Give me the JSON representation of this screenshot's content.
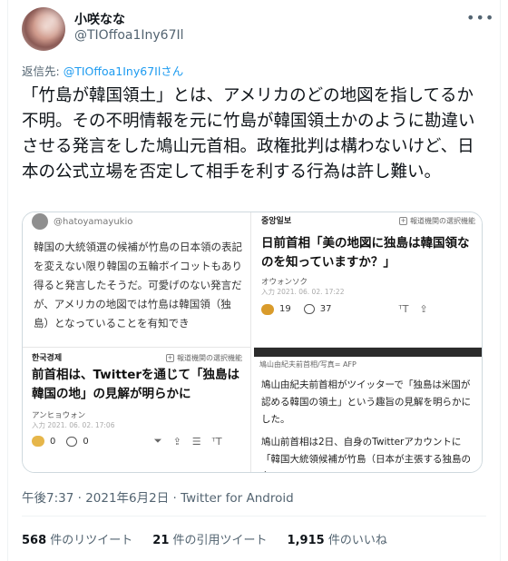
{
  "author": {
    "name": "小咲なな",
    "handle": "@TIOffoa1Iny67Il"
  },
  "reply": {
    "prefix": "返信先:",
    "target": "@TIOffoa1Iny67Ilさん"
  },
  "tweet_text": "「竹島が韓国領土」とは、アメリカのどの地図を指してるか不明。その不明情報を元に竹島が韓国領土かのように勘違いさせる発言をした鳩山元首相。政権批判は構わないけど、日本の公式立場を否定して相手を利する行為は許し難い。",
  "media": {
    "hato": {
      "handle": "@hatoyamayukio",
      "body": "韓国の大統領選の候補が竹島の日本領の表記を変えない限り韓国の五輪ボイコットもあり得ると発言したそうだ。可愛げのない発言だが、アメリカの地図では竹島は韓国領（独島）となっていることを有知でき"
    },
    "joongang": {
      "source": "중앙일보",
      "selection": "報道機関の選択機能",
      "headline": "日前首相「美の地図に独島は韓国領なのを知っていますか？」",
      "author": "オウォンソク",
      "date": "入力 2021. 06. 02. 17:22",
      "reactions": "19",
      "comments": "37"
    },
    "hankyung": {
      "source": "한국경제",
      "selection": "報道機関の選択機能",
      "headline": "前首相は、Twitterを通じて「独島は韓国の地」の見解が明らかに",
      "author": "アンヒョウォン",
      "date": "入力 2021. 06. 02. 17:06",
      "reactions": "0",
      "comments": "0"
    },
    "afp": {
      "caption": "鳩山由紀夫前首相/写真= AFP",
      "para1": "鳩山由紀夫前首相がツイッターで「独島は米国が認める韓国の領土」という趣旨の見解を明らかにした。",
      "para2": "鳩山前首相は2日、自身のTwitterアカウントに「韓国大統領候補が竹島（日本が主張する独島の名"
    }
  },
  "timestamp": "午後7:37 · 2021年6月2日 · Twitter for Android",
  "stats": {
    "retweets_count": "568",
    "retweets_label": "件のリツイート",
    "quotes_count": "21",
    "quotes_label": "件の引用ツイート",
    "likes_count": "1,915",
    "likes_label": "件のいいね"
  },
  "icons": {
    "more": "more-horizontal-icon",
    "like": "heart-icon",
    "share": "share-icon"
  }
}
